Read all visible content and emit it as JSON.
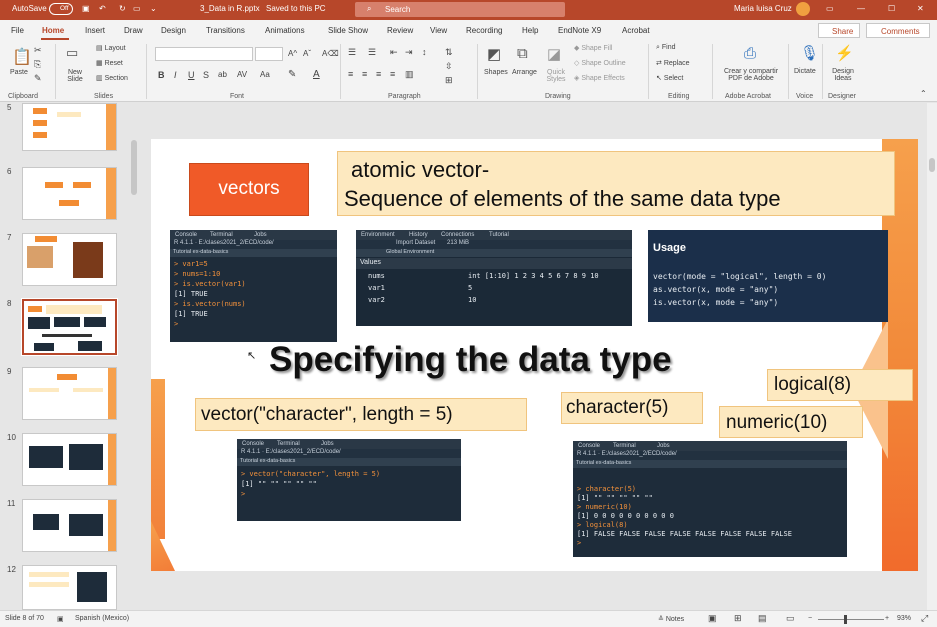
{
  "titlebar": {
    "autosave": "AutoSave",
    "autosave_state": "Off",
    "filename": "3_Data in R.pptx",
    "saved": "Saved to this PC",
    "search": "Search",
    "user": "Maria luisa Cruz"
  },
  "menu": [
    "File",
    "Home",
    "Insert",
    "Draw",
    "Design",
    "Transitions",
    "Animations",
    "Slide Show",
    "Review",
    "View",
    "Recording",
    "Help",
    "EndNote X9",
    "Acrobat"
  ],
  "share": "Share",
  "comments": "Comments",
  "ribbon": {
    "clipboard": {
      "paste": "Paste",
      "group": "Clipboard"
    },
    "slides": {
      "new_slide": "New Slide",
      "layout": "Layout",
      "reset": "Reset",
      "section": "Section",
      "group": "Slides"
    },
    "font": {
      "group": "Font"
    },
    "paragraph": {
      "group": "Paragraph"
    },
    "drawing": {
      "shapes": "Shapes",
      "arrange": "Arrange",
      "quick_styles": "Quick Styles",
      "shape_fill": "Shape Fill",
      "shape_outline": "Shape Outline",
      "shape_effects": "Shape Effects",
      "group": "Drawing"
    },
    "editing": {
      "find": "Find",
      "replace": "Replace",
      "select": "Select",
      "group": "Editing"
    },
    "adobe": {
      "create": "Crear y compartir PDF de Adobe",
      "group": "Adobe Acrobat"
    },
    "voice": {
      "dictate": "Dictate",
      "group": "Voice"
    },
    "designer": {
      "ideas": "Design Ideas",
      "group": "Designer"
    }
  },
  "thumbnails": [
    "5",
    "6",
    "7",
    "8",
    "9",
    "10",
    "11",
    "12"
  ],
  "slide": {
    "vectors": "vectors",
    "atomic_line1": "atomic  vector-",
    "atomic_line2": "Sequence of elements of the same data type",
    "console1": {
      "tabs": [
        "Console",
        "Terminal",
        "Jobs"
      ],
      "path": "R 4.1.1 · E:/clases2021_2/ECD/code/",
      "bar": "Tutorial ex-data-basics",
      "lines": [
        "> var1=5",
        "> nums=1:10",
        "> is.vector(var1)",
        "[1] TRUE",
        "> is.vector(nums)",
        "[1] TRUE",
        ">"
      ]
    },
    "env": {
      "tabs": [
        "Environment",
        "History",
        "Connections",
        "Tutorial"
      ],
      "toolbar": "Import Dataset",
      "mem": "213 MiB",
      "scope": "Global Environment",
      "header": "Values",
      "rows": [
        [
          "nums",
          "int [1:10] 1 2 3 4 5 6 7 8 9 10"
        ],
        [
          "var1",
          "5"
        ],
        [
          "var2",
          "10"
        ]
      ]
    },
    "usage": {
      "title": "Usage",
      "lines": [
        "vector(mode = \"logical\", length = 0)",
        "as.vector(x, mode = \"any\")",
        "is.vector(x, mode = \"any\")"
      ]
    },
    "heading": "Specifying the data type",
    "logical": "logical(8)",
    "character": "character(5)",
    "numeric": "numeric(10)",
    "vector_char": "vector(\"character\", length = 5)",
    "console2": {
      "tabs": [
        "Console",
        "Terminal",
        "Jobs"
      ],
      "path": "R 4.1.1 · E:/clases2021_2/ECD/code/",
      "bar": "Tutorial ex-data-basics",
      "lines": [
        "> vector(\"character\", length = 5)",
        "[1] \"\" \"\" \"\" \"\" \"\"",
        ">"
      ]
    },
    "console3": {
      "tabs": [
        "Console",
        "Terminal",
        "Jobs"
      ],
      "path": "R 4.1.1 · E:/clases2021_2/ECD/code/",
      "bar": "Tutorial ex-data-basics",
      "lines": [
        "> character(5)",
        "[1] \"\" \"\" \"\" \"\" \"\"",
        "> numeric(10)",
        "[1] 0 0 0 0 0 0 0 0 0 0",
        "> logical(8)",
        "[1] FALSE FALSE FALSE FALSE FALSE FALSE FALSE FALSE",
        ">"
      ]
    }
  },
  "status": {
    "slide": "Slide 8 of 70",
    "lang": "Spanish (Mexico)",
    "notes": "Notes",
    "zoom": "93%"
  }
}
